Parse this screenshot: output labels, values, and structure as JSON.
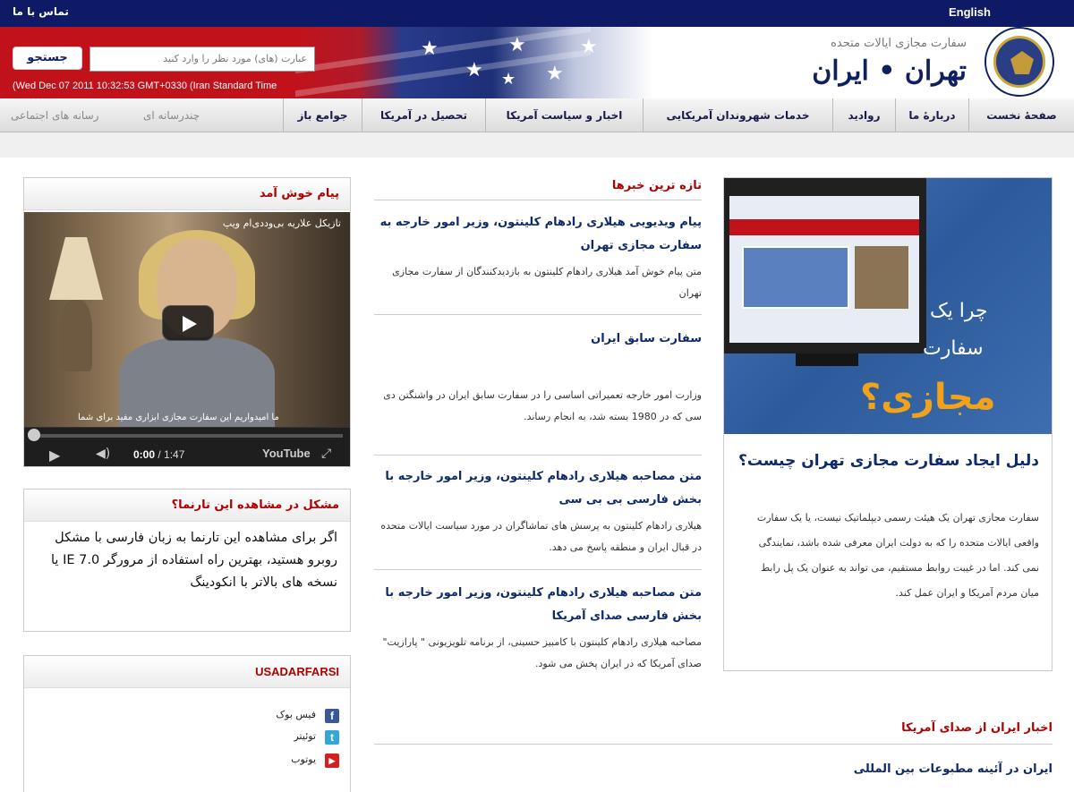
{
  "topbar": {
    "contact": "تماس با ما",
    "english": "English"
  },
  "header": {
    "search_placeholder": "عبارت (های) مورد نظر را وارد کنید",
    "search_button": "جستجو",
    "timestamp": "(Wed Dec 07 2011 10:32:53 GMT+0330 (Iran Standard Time",
    "brand_subtitle": "سفارت مجازی ایالات متحده",
    "brand_title": "تهران • ایران"
  },
  "nav": {
    "items": [
      "صفحهٔ نخست",
      "دربارهٔ ما",
      "روادید",
      "خدمات شهروندان آمریکایی",
      "اخبار و سیاست آمریکا",
      "تحصیل در آمریکا",
      "جوامع باز"
    ],
    "social": [
      "چندرسانه ای",
      "رسانه های اجتماعی"
    ]
  },
  "welcome": {
    "title": "پیام خوش آمد",
    "video_title": "تازیکل علاریه بی‌وددی‌ام ویپ",
    "video_caption": "ما امیدواریم این سفارت مجازی ابزاری مفید برای شما",
    "time_current": "0:00",
    "time_total": " / 1:47",
    "youtube": "YouTube"
  },
  "problem": {
    "title": "مشکل در مشاهده این تارنما؟",
    "text": "اگر برای مشاهده این تارنما به زبان فارسی با مشکل روبرو هستید، بهترین راه استفاده از مرورگر IE 7.0 یا نسخه های بالاتر با انکودینگ"
  },
  "social": {
    "title": "USADARFARSI",
    "links": [
      {
        "label": "فیس بوک",
        "icon": "f",
        "color": "#3b5998"
      },
      {
        "label": "توئیتر",
        "icon": "t",
        "color": "#33a7d8"
      },
      {
        "label": "یوتوب",
        "icon": "▶",
        "color": "#d61f1f"
      }
    ]
  },
  "latest": {
    "title": "تازه ترین خبرها",
    "items": [
      {
        "title": "پیام ویدیویی هیلاری رادهام کلینتون، وزیر امور خارجه به سفارت مجازی تهران",
        "text": "متن پیام خوش آمد هیلاری رادهام کلینتون به بازدیدکنندگان از سفارت مجازی تهران"
      },
      {
        "title": "سفارت سابق ایران",
        "text": "وزارت امور خارجه تعمیراتی اساسی را در سفارت سابق ایران در واشنگتن دی سی که در 1980 بسته شد، به انجام رساند."
      },
      {
        "title": "متن مصاحبه هیلاری رادهام کلینتون، وزیر امور خارجه با بخش فارسی بی بی سی",
        "text": "هیلاری رادهام کلینتون به پرسش های تماشاگران در مورد سیاست ایالات متحده در قبال ایران و منطقه پاسخ می دهد."
      },
      {
        "title": "متن مصاحبه هیلاری رادهام کلینتون، وزیر امور خارجه با بخش فارسی صدای آمریکا",
        "text": "مصاحبه هیلاری رادهام کلینتون با کامبیز حسینی، از برنامه تلویزیونی \" پارازیت\" صدای آمریکا که در ایران پخش می شود."
      }
    ]
  },
  "promo": {
    "line1": "چرا یک",
    "line2": "سفارت",
    "line3": "مجازی؟",
    "title": "دلیل ایجاد سفارت مجازی تهران چیست؟",
    "text": "سفارت مجازی تهران یک هیئت رسمی دیپلماتیک نیست، یا یک سفارت واقعی ایالات متحده را که به دولت ایران معرفی شده باشد، نمایندگی نمی کند. اما در غیبت روابط مستقیم، می تواند به عنوان یک پل رابط میان مردم آمریکا و ایران عمل کند."
  },
  "voa": {
    "title": "اخبار ایران از صدای آمریکا",
    "item": "ایران در آئینه مطبوعات بین المللی"
  },
  "colors": {
    "navy": "#0e1a66",
    "red": "#c1121b",
    "link_blue": "#0f2a6b",
    "section_red": "#b00000"
  }
}
